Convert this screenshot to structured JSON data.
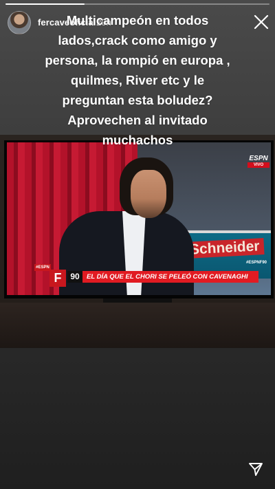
{
  "story": {
    "progress_fraction": 0.3
  },
  "header": {
    "username": "fercaveoficial",
    "time": "20h",
    "avatar_icon": "user-avatar",
    "close_icon": "close-icon"
  },
  "caption": {
    "text": "Multicampeón en todos lados,crack como amigo y persona, la rompió en europa , quilmes, River etc y le preguntan esta boludez? Aprovechen al invitado muchachos"
  },
  "tv": {
    "channel_logo": "ESPN",
    "channel_live": "VIVO",
    "sponsor": "Schneider",
    "sponsor_tag": "#ESPNF90",
    "lower_third_brand": "#ESPN",
    "show_letter": "F",
    "show_number": "90",
    "headline": "EL DÍA QUE EL CHORI SE PELEÓ CON CAVENAGHI"
  },
  "footer": {
    "send_icon": "send-icon"
  },
  "colors": {
    "accent_red": "#e11b22",
    "text": "#ffffff"
  }
}
